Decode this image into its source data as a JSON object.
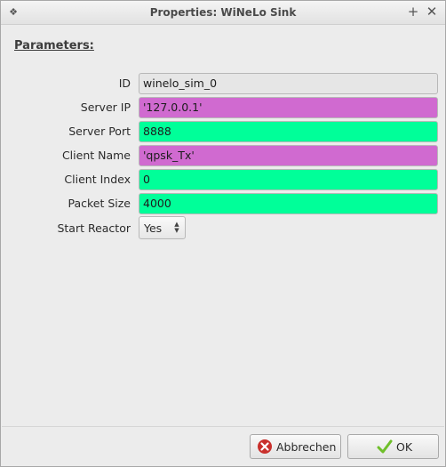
{
  "window": {
    "title": "Properties: WiNeLo Sink",
    "buttons": {
      "left_glyph": "❖",
      "maximize_glyph": "+",
      "close_glyph": "✕"
    }
  },
  "section": {
    "title": "Parameters:"
  },
  "params": [
    {
      "label": "ID",
      "value": "winelo_sim_0",
      "bg": "#e6e6e6"
    },
    {
      "label": "Server IP",
      "value": "'127.0.0.1'",
      "bg": "#d06ad0"
    },
    {
      "label": "Server Port",
      "value": "8888",
      "bg": "#00ff99"
    },
    {
      "label": "Client Name",
      "value": "'qpsk_Tx'",
      "bg": "#d06ad0"
    },
    {
      "label": "Client Index",
      "value": "0",
      "bg": "#00ff99"
    },
    {
      "label": "Packet Size",
      "value": "4000",
      "bg": "#00ff99"
    }
  ],
  "start_reactor": {
    "label": "Start Reactor",
    "value": "Yes"
  },
  "footer": {
    "cancel_label": "Abbrechen",
    "ok_label": "OK",
    "cancel_icon": "cancel-icon",
    "ok_icon": "checkmark-icon",
    "cancel_icon_color": "#c9302c",
    "ok_icon_color": "#6fbf2a"
  }
}
